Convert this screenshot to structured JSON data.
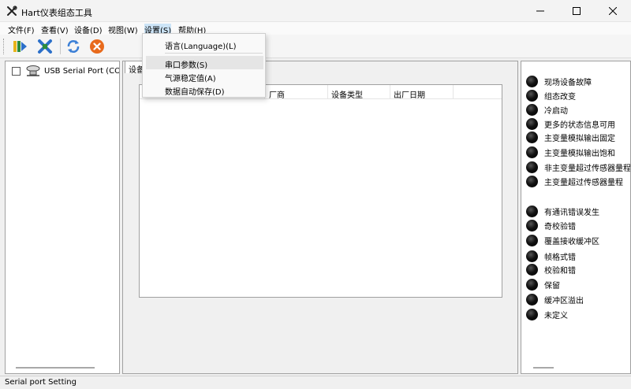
{
  "window": {
    "title": "Hart仪表组态工具",
    "controls": [
      "minimize-icon",
      "maximize-icon",
      "close-icon"
    ]
  },
  "menubar": {
    "items": [
      {
        "label": "文件(F)"
      },
      {
        "label": "查看(V)"
      },
      {
        "label": "设备(D)"
      },
      {
        "label": "视图(W)"
      },
      {
        "label": "设置(S)"
      },
      {
        "label": "帮助(H)"
      }
    ],
    "active_item": "设置(S)"
  },
  "toolbar": {
    "buttons": [
      {
        "icon": "connect-icon"
      },
      {
        "icon": "disconnect-icon"
      },
      {
        "icon": "refresh-icon"
      },
      {
        "icon": "stop-icon"
      }
    ]
  },
  "settings_menu": {
    "items": [
      {
        "label": "语言(Language)(L)"
      },
      {
        "label": "串口参数(S)"
      },
      {
        "label": "气源稳定值(A)"
      },
      {
        "label": "数据自动保存(D)"
      }
    ],
    "highlighted": "串口参数(S)"
  },
  "device_tree": {
    "items": [
      {
        "label": "USB Serial Port (COM",
        "checked": false,
        "icon": "serial-port-icon"
      }
    ]
  },
  "device_tab": {
    "label": "设备"
  },
  "device_list": {
    "columns": [
      "",
      "",
      "厂商",
      "设备类型",
      "出厂日期"
    ]
  },
  "status_panel": {
    "group1": [
      "现场设备故障",
      "组态改变",
      "冷启动",
      "更多的状态信息可用",
      "主变量模拟输出固定",
      "主变量模拟输出饱和",
      "非主变量超过传感器量程",
      "主变量超过传感器量程"
    ],
    "group2": [
      "有通讯错误发生",
      "奇校验错",
      "覆盖接收缓冲区",
      "帧格式错",
      "校验和错",
      "保留",
      "缓冲区溢出",
      "未定义"
    ],
    "led_color": "#000000"
  },
  "statusbar": {
    "text": "Serial port Setting"
  }
}
